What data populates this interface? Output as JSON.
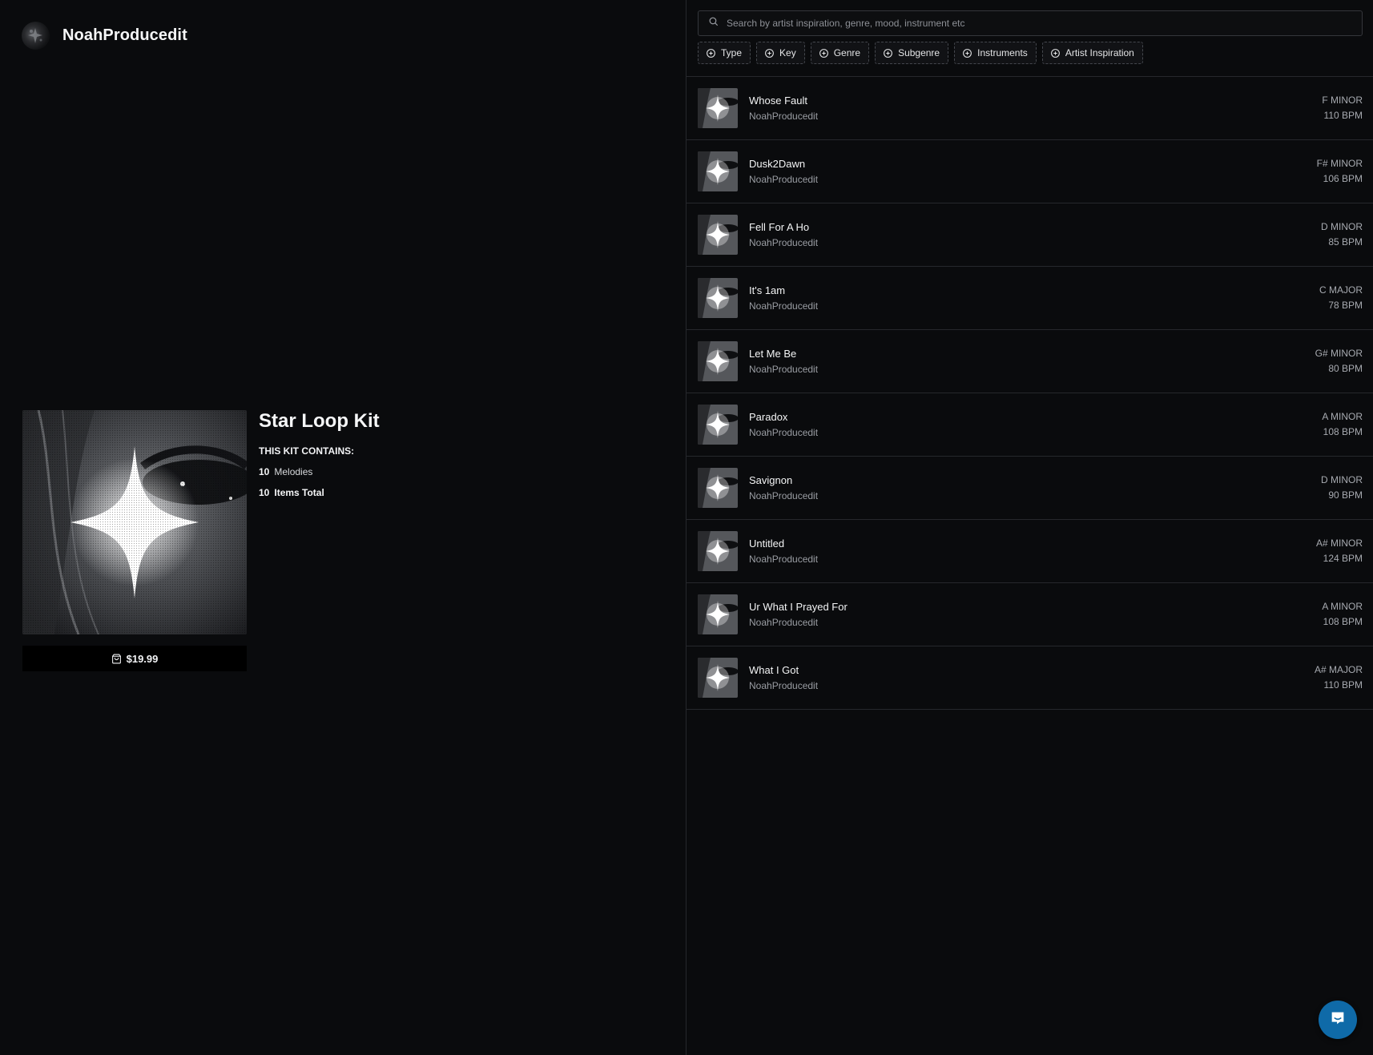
{
  "brand": {
    "name": "NoahProducedit"
  },
  "kit": {
    "title": "Star Loop Kit",
    "contains_label": "THIS KIT CONTAINS:",
    "melodies_count": "10",
    "melodies_label": "Melodies",
    "total_count": "10",
    "total_label": "Items Total",
    "price": "$19.99"
  },
  "search": {
    "placeholder": "Search by artist inspiration, genre, mood, instrument etc"
  },
  "filters": [
    "Type",
    "Key",
    "Genre",
    "Subgenre",
    "Instruments",
    "Artist Inspiration"
  ],
  "tracks": [
    {
      "title": "Whose Fault",
      "artist": "NoahProducedit",
      "key": "F MINOR",
      "bpm": "110 BPM"
    },
    {
      "title": "Dusk2Dawn",
      "artist": "NoahProducedit",
      "key": "F# MINOR",
      "bpm": "106 BPM"
    },
    {
      "title": "Fell For A Ho",
      "artist": "NoahProducedit",
      "key": "D MINOR",
      "bpm": "85 BPM"
    },
    {
      "title": "It's 1am",
      "artist": "NoahProducedit",
      "key": "C MAJOR",
      "bpm": "78 BPM"
    },
    {
      "title": "Let Me Be",
      "artist": "NoahProducedit",
      "key": "G# MINOR",
      "bpm": "80 BPM"
    },
    {
      "title": "Paradox",
      "artist": "NoahProducedit",
      "key": "A MINOR",
      "bpm": "108 BPM"
    },
    {
      "title": "Savignon",
      "artist": "NoahProducedit",
      "key": "D MINOR",
      "bpm": "90 BPM"
    },
    {
      "title": "Untitled",
      "artist": "NoahProducedit",
      "key": "A# MINOR",
      "bpm": "124 BPM"
    },
    {
      "title": "Ur What I Prayed For",
      "artist": "NoahProducedit",
      "key": "A MINOR",
      "bpm": "108 BPM"
    },
    {
      "title": "What I Got",
      "artist": "NoahProducedit",
      "key": "A# MAJOR",
      "bpm": "110 BPM"
    }
  ],
  "icons": {
    "search": "search-icon",
    "filter": "plus-circle-icon",
    "buy": "shopping-bag-icon",
    "chat": "chat-icon"
  },
  "colors": {
    "background": "#0a0b0d",
    "divider": "#26282c",
    "chat_accent": "#0f6aa8"
  }
}
